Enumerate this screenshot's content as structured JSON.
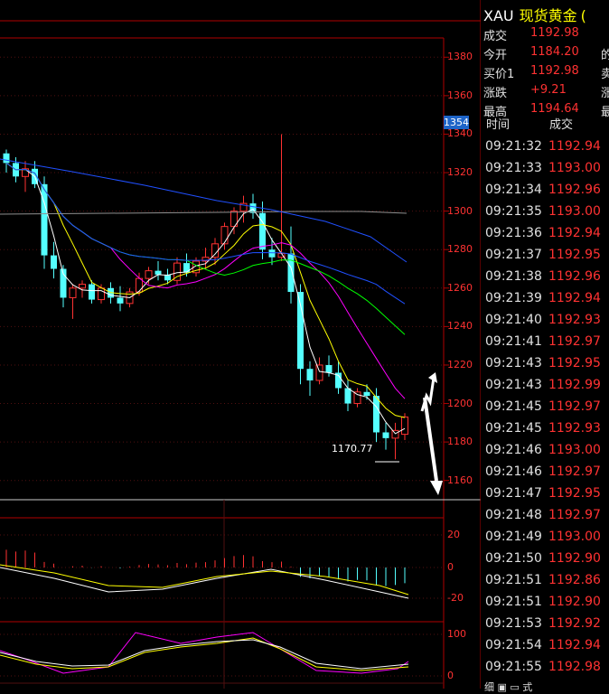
{
  "header": {
    "symbol": "XAU",
    "name": "现货黄金",
    "mark": "("
  },
  "quote": [
    {
      "label": "成交",
      "value": "1192.98",
      "trail": ""
    },
    {
      "label": "今开",
      "value": "1184.20",
      "trail": "的"
    },
    {
      "label": "买价1",
      "value": "1192.98",
      "trail": "卖"
    },
    {
      "label": "涨跌",
      "value": "+9.21",
      "trail": "涨"
    },
    {
      "label": "最高",
      "value": "1194.64",
      "trail": "最"
    }
  ],
  "ticks_header": {
    "time": "时间",
    "price": "成交"
  },
  "ticks": [
    {
      "time": "09:21:32",
      "price": "1192.94"
    },
    {
      "time": "09:21:33",
      "price": "1193.00"
    },
    {
      "time": "09:21:34",
      "price": "1192.96"
    },
    {
      "time": "09:21:35",
      "price": "1193.00"
    },
    {
      "time": "09:21:36",
      "price": "1192.94"
    },
    {
      "time": "09:21:37",
      "price": "1192.95"
    },
    {
      "time": "09:21:38",
      "price": "1192.96"
    },
    {
      "time": "09:21:39",
      "price": "1192.94"
    },
    {
      "time": "09:21:40",
      "price": "1192.93"
    },
    {
      "time": "09:21:41",
      "price": "1192.97"
    },
    {
      "time": "09:21:43",
      "price": "1192.95"
    },
    {
      "time": "09:21:43",
      "price": "1192.99"
    },
    {
      "time": "09:21:45",
      "price": "1192.97"
    },
    {
      "time": "09:21:45",
      "price": "1192.93"
    },
    {
      "time": "09:21:46",
      "price": "1193.00"
    },
    {
      "time": "09:21:46",
      "price": "1192.97"
    },
    {
      "time": "09:21:47",
      "price": "1192.95"
    },
    {
      "time": "09:21:48",
      "price": "1192.97"
    },
    {
      "time": "09:21:49",
      "price": "1193.00"
    },
    {
      "time": "09:21:50",
      "price": "1192.90"
    },
    {
      "time": "09:21:51",
      "price": "1192.86"
    },
    {
      "time": "09:21:51",
      "price": "1192.90"
    },
    {
      "time": "09:21:53",
      "price": "1192.92"
    },
    {
      "time": "09:21:54",
      "price": "1192.94"
    },
    {
      "time": "09:21:55",
      "price": "1192.98"
    }
  ],
  "price_axis": [
    "1380",
    "1360",
    "1340",
    "1320",
    "1300",
    "1280",
    "1260",
    "1240",
    "1220",
    "1200",
    "1180",
    "1160"
  ],
  "price_badge": "1354",
  "low_marker": "1170.77",
  "macd_axis": [
    "20",
    "0",
    "-20"
  ],
  "kdj_axis": [
    "100",
    "0"
  ],
  "bottom_tabs": "细   ▣   ▭   式",
  "chart_data": {
    "type": "candlestick",
    "ylim": [
      1150,
      1390
    ],
    "candles": [
      {
        "o": 1330,
        "h": 1332,
        "l": 1320,
        "c": 1325
      },
      {
        "o": 1325,
        "h": 1328,
        "l": 1315,
        "c": 1318
      },
      {
        "o": 1318,
        "h": 1326,
        "l": 1310,
        "c": 1322
      },
      {
        "o": 1322,
        "h": 1326,
        "l": 1312,
        "c": 1314
      },
      {
        "o": 1314,
        "h": 1318,
        "l": 1270,
        "c": 1277
      },
      {
        "o": 1277,
        "h": 1284,
        "l": 1265,
        "c": 1270
      },
      {
        "o": 1270,
        "h": 1272,
        "l": 1250,
        "c": 1255
      },
      {
        "o": 1255,
        "h": 1262,
        "l": 1244,
        "c": 1260
      },
      {
        "o": 1260,
        "h": 1264,
        "l": 1255,
        "c": 1262
      },
      {
        "o": 1262,
        "h": 1264,
        "l": 1252,
        "c": 1254
      },
      {
        "o": 1254,
        "h": 1262,
        "l": 1252,
        "c": 1260
      },
      {
        "o": 1260,
        "h": 1263,
        "l": 1252,
        "c": 1255
      },
      {
        "o": 1255,
        "h": 1261,
        "l": 1248,
        "c": 1252
      },
      {
        "o": 1252,
        "h": 1260,
        "l": 1250,
        "c": 1258
      },
      {
        "o": 1258,
        "h": 1268,
        "l": 1256,
        "c": 1265
      },
      {
        "o": 1265,
        "h": 1271,
        "l": 1262,
        "c": 1269
      },
      {
        "o": 1269,
        "h": 1274,
        "l": 1264,
        "c": 1267
      },
      {
        "o": 1267,
        "h": 1270,
        "l": 1262,
        "c": 1264
      },
      {
        "o": 1264,
        "h": 1276,
        "l": 1262,
        "c": 1273
      },
      {
        "o": 1273,
        "h": 1278,
        "l": 1266,
        "c": 1268
      },
      {
        "o": 1268,
        "h": 1276,
        "l": 1266,
        "c": 1274
      },
      {
        "o": 1274,
        "h": 1281,
        "l": 1270,
        "c": 1276
      },
      {
        "o": 1276,
        "h": 1286,
        "l": 1272,
        "c": 1283
      },
      {
        "o": 1283,
        "h": 1294,
        "l": 1280,
        "c": 1292
      },
      {
        "o": 1292,
        "h": 1302,
        "l": 1288,
        "c": 1300
      },
      {
        "o": 1300,
        "h": 1308,
        "l": 1294,
        "c": 1304
      },
      {
        "o": 1304,
        "h": 1309,
        "l": 1296,
        "c": 1299
      },
      {
        "o": 1299,
        "h": 1305,
        "l": 1275,
        "c": 1280
      },
      {
        "o": 1280,
        "h": 1286,
        "l": 1272,
        "c": 1276
      },
      {
        "o": 1276,
        "h": 1340,
        "l": 1274,
        "c": 1278
      },
      {
        "o": 1278,
        "h": 1292,
        "l": 1252,
        "c": 1258
      },
      {
        "o": 1258,
        "h": 1262,
        "l": 1210,
        "c": 1218
      },
      {
        "o": 1218,
        "h": 1222,
        "l": 1204,
        "c": 1212
      },
      {
        "o": 1212,
        "h": 1224,
        "l": 1210,
        "c": 1220
      },
      {
        "o": 1220,
        "h": 1225,
        "l": 1214,
        "c": 1216
      },
      {
        "o": 1216,
        "h": 1222,
        "l": 1205,
        "c": 1208
      },
      {
        "o": 1208,
        "h": 1212,
        "l": 1196,
        "c": 1200
      },
      {
        "o": 1200,
        "h": 1208,
        "l": 1198,
        "c": 1206
      },
      {
        "o": 1206,
        "h": 1210,
        "l": 1202,
        "c": 1204
      },
      {
        "o": 1204,
        "h": 1208,
        "l": 1180,
        "c": 1185
      },
      {
        "o": 1185,
        "h": 1190,
        "l": 1176,
        "c": 1182
      },
      {
        "o": 1182,
        "h": 1190,
        "l": 1171,
        "c": 1186
      },
      {
        "o": 1184,
        "h": 1195,
        "l": 1181,
        "c": 1193
      }
    ]
  }
}
